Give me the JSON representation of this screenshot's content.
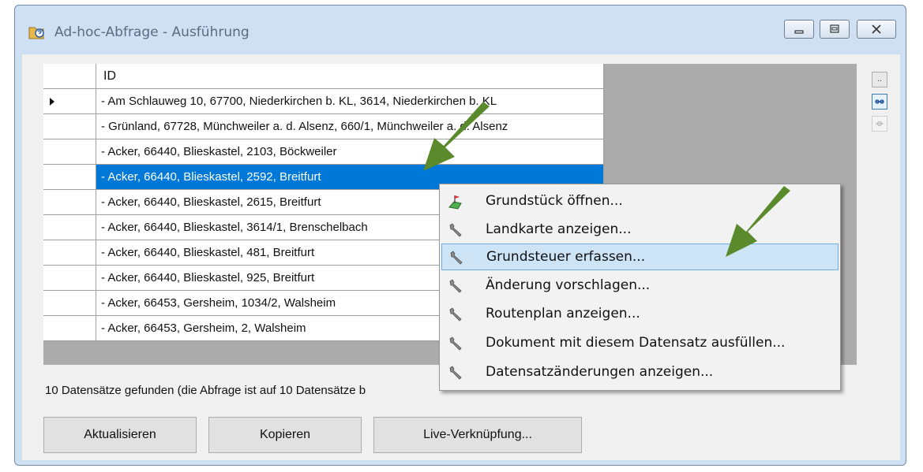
{
  "window": {
    "title": "Ad-hoc-Abfrage - Ausführung",
    "icon": "query-folder-icon"
  },
  "grid": {
    "column_header": "ID",
    "rows": [
      "-   Am Schlauweg 10, 67700, Niederkirchen b. KL, 3614, Niederkirchen b. KL",
      "-   Grünland, 67728, Münchweiler a. d. Alsenz, 660/1, Münchweiler a. d. Alsenz",
      "-  Acker, 66440, Blieskastel, 2103, Böckweiler",
      "-  Acker, 66440, Blieskastel, 2592, Breitfurt",
      "-  Acker, 66440, Blieskastel, 2615, Breitfurt",
      "-  Acker, 66440, Blieskastel, 3614/1, Brenschelbach",
      "-  Acker, 66440, Blieskastel, 481, Breitfurt",
      "-  Acker, 66440, Blieskastel, 925, Breitfurt",
      "-  Acker, 66453, Gersheim, 1034/2, Walsheim",
      "-  Acker, 66453, Gersheim, 2, Walsheim"
    ],
    "selected_row": 3,
    "current_row": 0
  },
  "side_buttons": [
    "..",
    "link-icon",
    "unlink-icon"
  ],
  "status": "10 Datensätze gefunden (die Abfrage ist auf 10 Datensätze b",
  "buttons": {
    "refresh": "Aktualisieren",
    "copy": "Kopieren",
    "live_link": "Live-Verknüpfung..."
  },
  "context_menu": {
    "items": [
      {
        "label": "Grundstück öffnen...",
        "icon": "parcel-flag-icon"
      },
      {
        "label": "Landkarte anzeigen...",
        "icon": "wrench-icon"
      },
      {
        "label": "Grundsteuer erfassen...",
        "icon": "wrench-icon"
      },
      {
        "label": "Änderung vorschlagen...",
        "icon": "wrench-icon"
      },
      {
        "label": "Routenplan anzeigen...",
        "icon": "wrench-icon"
      },
      {
        "label": "Dokument mit diesem Datensatz ausfüllen...",
        "icon": "wrench-icon"
      },
      {
        "label": "Datensatzänderungen anzeigen...",
        "icon": "wrench-icon"
      }
    ],
    "highlighted_index": 2
  },
  "colors": {
    "selection": "#0078d7",
    "menu_highlight": "#cde4f7",
    "arrow": "#5a8a2c"
  }
}
